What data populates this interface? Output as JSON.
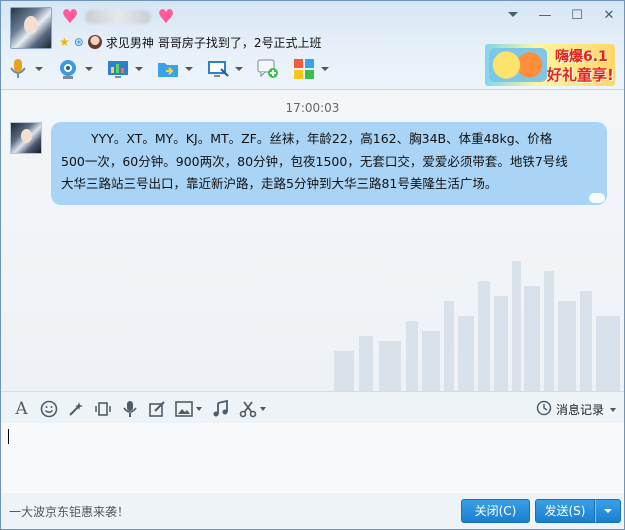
{
  "header": {
    "signature": "哥哥房子找到了，2号正式上班",
    "signature_name": "求见男神",
    "banner": {
      "line1": "嗨爆6.1",
      "line2": "好礼童享!"
    }
  },
  "window_controls": {
    "minimize": "—",
    "maximize": "☐",
    "close": "✕"
  },
  "toolbar": {
    "items": [
      {
        "name": "voice-call",
        "icon": "microphone-icon"
      },
      {
        "name": "video-call",
        "icon": "camera-icon"
      },
      {
        "name": "remote-desktop",
        "icon": "screen-icon"
      },
      {
        "name": "send-file",
        "icon": "folder-icon"
      },
      {
        "name": "screen-share",
        "icon": "monitor-icon"
      },
      {
        "name": "new-group",
        "icon": "chat-add-icon"
      },
      {
        "name": "apps",
        "icon": "apps-grid-icon"
      }
    ]
  },
  "chat": {
    "timestamp": "17:00:03",
    "message": {
      "line1": "YYY。XT。MY。KJ。MT。ZF。丝袜，年龄22，高162、胸34B、体重48kg、价格",
      "line2": "500一次，60分钟。900两次，80分钟，包夜1500，无套口交，爱爱必须带套。地铁7号线",
      "line3": "大华三路站三号出口，靠近新沪路，走路5分钟到大华三路81号美隆生活广场。"
    }
  },
  "input_toolbar": {
    "history_label": "消息记录",
    "font_glyph": "A"
  },
  "bottom": {
    "promo": "一大波京东钜惠来袭！",
    "close_label": "关闭(C)",
    "send_label": "发送(S)"
  },
  "colors": {
    "bubble": "#a9d4f5",
    "button": "#1a7fcf",
    "accent_red": "#e2251c"
  }
}
